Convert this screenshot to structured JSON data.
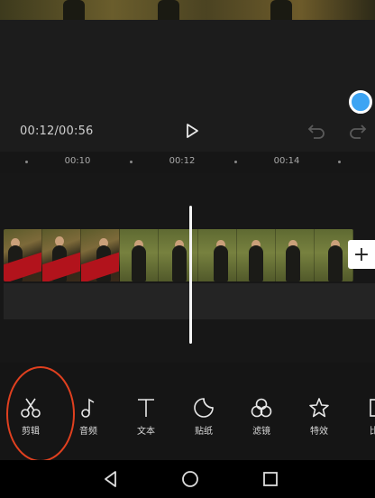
{
  "player": {
    "time": "00:12/00:56"
  },
  "ruler": {
    "ticks": [
      "00:10",
      "00:12",
      "00:14"
    ]
  },
  "timeline": {
    "add_clip_label": "+"
  },
  "toolbar": {
    "items": [
      {
        "id": "cut",
        "label": "剪辑",
        "icon": "scissors-icon"
      },
      {
        "id": "audio",
        "label": "音频",
        "icon": "music-note-icon"
      },
      {
        "id": "text",
        "label": "文本",
        "icon": "text-icon"
      },
      {
        "id": "sticker",
        "label": "贴纸",
        "icon": "sticker-icon"
      },
      {
        "id": "filter",
        "label": "滤镜",
        "icon": "filter-icon"
      },
      {
        "id": "effects",
        "label": "特效",
        "icon": "effects-star-icon"
      },
      {
        "id": "more",
        "label": "比",
        "icon": "partial-icon"
      }
    ]
  },
  "colors": {
    "accent_blue": "#3da4f3",
    "highlight_red": "#e0401f"
  }
}
